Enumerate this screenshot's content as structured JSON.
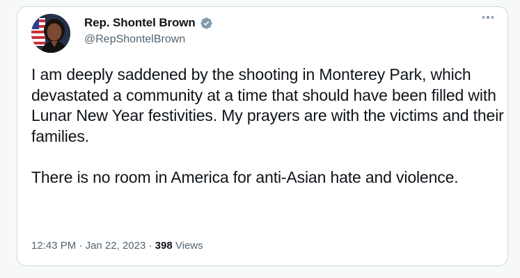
{
  "author": {
    "display_name": "Rep. Shontel Brown",
    "handle": "@RepShontelBrown",
    "verified": true,
    "verified_icon": "verified-badge-icon",
    "avatar_icon": "profile-avatar"
  },
  "menu": {
    "more_icon": "more-dots-icon"
  },
  "tweet": {
    "paragraphs": [
      "I am deeply saddened by the shooting in Monterey Park, which devastated a community at a time that should have been filled with Lunar New Year festivities. My prayers are with the victims and their families.",
      "There is no room in America for anti-Asian hate and violence."
    ]
  },
  "meta": {
    "time": "12:43 PM",
    "separator": " · ",
    "date": "Jan 22, 2023",
    "views_count": "398",
    "views_label": "Views"
  },
  "colors": {
    "verified_badge": "#829aab",
    "text_primary": "#0f1419",
    "text_secondary": "#536471",
    "border": "#cfd9de"
  }
}
